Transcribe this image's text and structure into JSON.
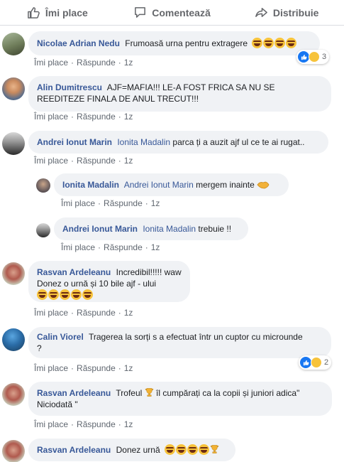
{
  "action_bar": {
    "like_label": "Îmi place",
    "comment_label": "Comentează",
    "share_label": "Distribuie"
  },
  "comment_actions": {
    "like": "Îmi place",
    "reply": "Răspunde",
    "time": "1z"
  },
  "comments": [
    {
      "author": "Nicolae Adrian Nedu",
      "text": "Frumoasă urna pentru extragere",
      "emoji_after": "😂😂😂😂",
      "reaction_count": "3",
      "reaction_types": [
        "like",
        "haha"
      ]
    },
    {
      "author": "Alin Dumitrescu",
      "text": "AJF=MAFIA!!! LE-A FOST FRICA SA NU SE REEDITEZE FINALA DE ANUL TRECUT!!!"
    },
    {
      "author": "Andrei Ionut Marin",
      "mention": "Ionita Madalin",
      "text": "parca ți a auzit ajf ul ce te ai rugat.."
    },
    {
      "author": "Ionita Madalin",
      "mention": "Andrei Ionut Marin",
      "text": "mergem inainte",
      "emoji_after": "🤝",
      "is_reply": true
    },
    {
      "author": "Andrei Ionut Marin",
      "mention": "Ionita Madalin",
      "text": "trebuie !!",
      "is_reply": true
    },
    {
      "author": "Rasvan Ardeleanu",
      "text_line1": "Incredibil!!!!! waw",
      "text_line2": "Donez o urnă și 10 bile ajf - ului",
      "emoji_line3": "😂😂😂😂😂"
    },
    {
      "author": "Calin Viorel",
      "text_line1": "Tragerea la sorți s a efectuat într un cuptor cu microunde",
      "text_line2": "?",
      "reaction_count": "2",
      "reaction_types": [
        "like",
        "haha"
      ]
    },
    {
      "author": "Rasvan Ardeleanu",
      "text_pre_trophy": "Trofeul",
      "trophy": "🏆",
      "text_post_trophy": "îl cumpărați ca la copii și juniori adica\"",
      "text_line2": "Niciodată \""
    },
    {
      "author": "Rasvan Ardeleanu",
      "text": "Donez urnă",
      "emoji_after": "😂😂😂😂🏆"
    }
  ],
  "colors": {
    "link_blue": "#385898",
    "bubble_bg": "#f0f2f5",
    "meta_gray": "#606770",
    "like_blue": "#1877f2",
    "haha_yellow": "#f7c33b"
  }
}
